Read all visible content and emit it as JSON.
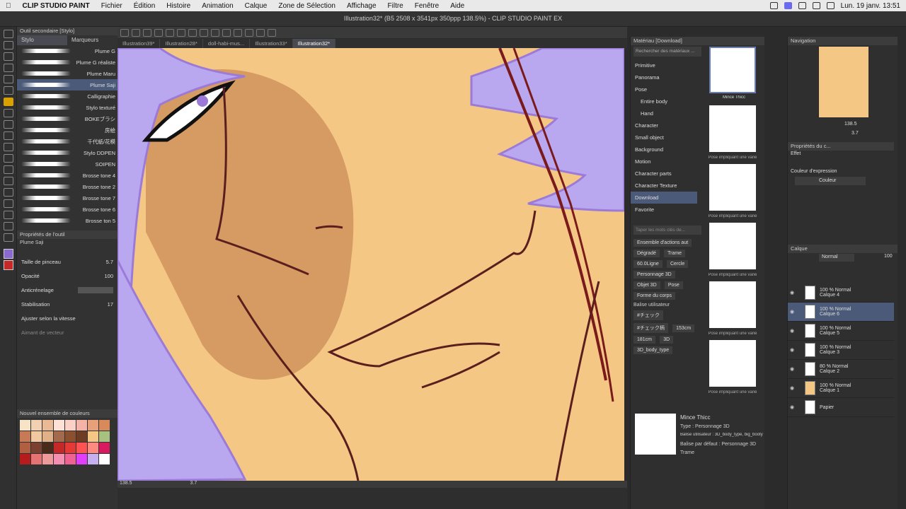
{
  "menubar": {
    "app": "CLIP STUDIO PAINT",
    "items": [
      "Fichier",
      "Édition",
      "Histoire",
      "Animation",
      "Calque",
      "Zone de Sélection",
      "Affichage",
      "Filtre",
      "Fenêtre",
      "Aide"
    ],
    "clock": "Lun. 19 janv.  13:51"
  },
  "window": {
    "title": "Illustration32* (B5 2508 x 3541px 350ppp 138.5%) - CLIP STUDIO PAINT EX"
  },
  "tabs": [
    "Illustration39*",
    "Illustration28*",
    "doll-habi-mus...",
    "Illustration33*",
    "Illustration32*"
  ],
  "subtool": {
    "header": "Outil secondaire [Stylo]",
    "tabs": [
      "Stylo",
      "Marqueurs"
    ],
    "brushes": [
      "Plume G",
      "Plume G réaliste",
      "Plume Maru",
      "Plume Saji",
      "Calligraphie",
      "Stylo texturé",
      "BOKEブラシ",
      "房絵",
      "千代紙/花模",
      "Stylo DDPEN",
      "SOIPEN",
      "Brosse tone 4",
      "Brosse tone 2",
      "Brosse tone 7",
      "Brosse tone 6",
      "Brosse ton 5"
    ]
  },
  "toolprops": {
    "header": "Propriétés de l'outil",
    "selected": "Plume Saji",
    "size_label": "Taille de pinceau",
    "size_value": "5.7",
    "opacity_label": "Opacité",
    "opacity_value": "100",
    "aa_label": "Anticrénelage",
    "stab_label": "Stabilisation",
    "stab_value": "17",
    "speed_label": "Ajuster selon la vitesse",
    "vector_label": "Aimant de vecteur"
  },
  "colorset": {
    "header": "Nouvel ensemble de couleurs"
  },
  "canvas_status": {
    "zoom": "138.5",
    "angle": "3.7"
  },
  "material": {
    "header": "Matériau [Download]",
    "search": "Rechercher des matériaux ...",
    "categories": [
      "Primitive",
      "Panorama",
      "Pose",
      "Entire body",
      "Hand",
      "Character",
      "Small object",
      "Background",
      "Motion",
      "Character parts",
      "Character Texture",
      "Download"
    ],
    "favorite": "Favorite",
    "tag_placeholder": "Taper les mots clés de...",
    "tags": [
      "Ensemble d'actions aut",
      "Dégradé",
      "Trame",
      "60.0Ligne",
      "Cercle",
      "Personnage 3D",
      "Objet 3D",
      "Pose",
      "Forme du corps",
      "Balise utilisateur",
      "#チェック",
      "#チェック柄",
      "153cm",
      "181cm",
      "3D",
      "3D_body_type"
    ],
    "thumb_caption": "Mince Thicc",
    "pose_caption": "Pose impliquant une varié",
    "detail": {
      "name": "Mince Thicc",
      "type": "Type : Personnage 3D",
      "tags": "Balise utilisateur : 3D_body_type, big_booty",
      "default": "Balise par défaut : Personnage 3D",
      "trame": "Trame"
    }
  },
  "navigation": {
    "header": "Navigation",
    "zoom": "138.5",
    "angle": "3.7"
  },
  "layerprops": {
    "header": "Propriétés du c...",
    "effect": "Effet",
    "expr_label": "Couleur d'expression",
    "expr_value": "Couleur"
  },
  "layers": {
    "header": "Calque",
    "blend": "Normal",
    "opacity": "100",
    "items": [
      {
        "mode": "100 % Normal",
        "name": "Calque 4"
      },
      {
        "mode": "100 % Normal",
        "name": "Calque 6"
      },
      {
        "mode": "100 % Normal",
        "name": "Calque 5"
      },
      {
        "mode": "100 % Normal",
        "name": "Calque 3"
      },
      {
        "mode": "80 % Normal",
        "name": "Calque 2"
      },
      {
        "mode": "100 % Normal",
        "name": "Calque 1"
      },
      {
        "mode": "",
        "name": "Papier"
      }
    ]
  },
  "colors": {
    "accent": "#4b5a78",
    "skin": "#f4c784",
    "hair": "#b9a8f0"
  }
}
